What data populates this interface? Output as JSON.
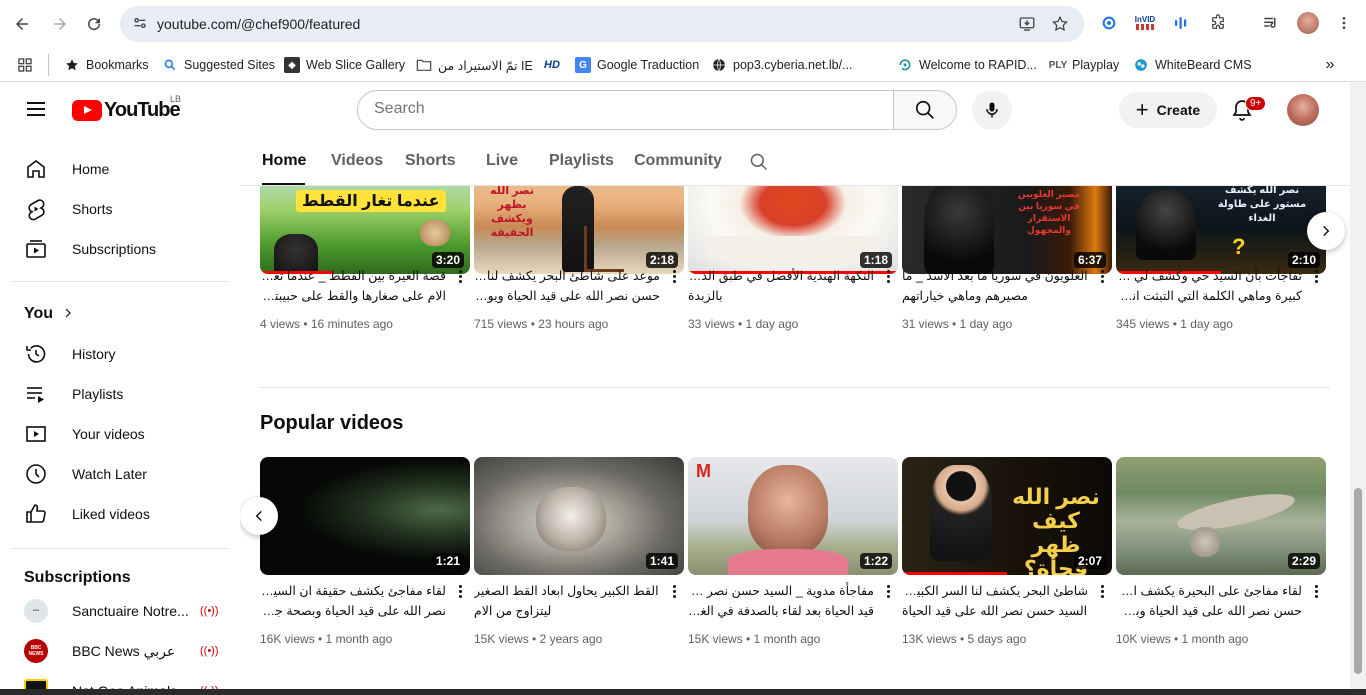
{
  "browser": {
    "url": "youtube.com/@chef900/featured",
    "bookmarks": [
      {
        "label": "Bookmarks",
        "icon": "star-icon"
      },
      {
        "label": "Suggested Sites",
        "icon": "search-icon"
      },
      {
        "label": "Web Slice Gallery",
        "icon": "web-slice-icon"
      },
      {
        "label": "تمّ الاستيراد من IE",
        "icon": "folder-icon"
      },
      {
        "label": "",
        "icon": "hd-icon"
      },
      {
        "label": "Google Traduction",
        "icon": "google-translate-icon"
      },
      {
        "label": "pop3.cyberia.net.lb/...",
        "icon": "globe-icon"
      },
      {
        "label": "Welcome to RAPID...",
        "icon": "rapid-icon"
      },
      {
        "label": "Playplay",
        "icon": "playplay-icon"
      },
      {
        "label": "WhiteBeard CMS",
        "icon": "whitebeard-icon"
      }
    ],
    "ext_invid": "InVID",
    "hd_label": "HD"
  },
  "header": {
    "logo_text": "YouTube",
    "country": "LB",
    "search_placeholder": "Search",
    "create_label": "Create",
    "notif_count": "9+"
  },
  "sidebar": {
    "main": [
      {
        "label": "Home",
        "icon": "home-icon"
      },
      {
        "label": "Shorts",
        "icon": "shorts-icon"
      },
      {
        "label": "Subscriptions",
        "icon": "subscriptions-icon"
      }
    ],
    "you_label": "You",
    "you": [
      {
        "label": "History",
        "icon": "history-icon"
      },
      {
        "label": "Playlists",
        "icon": "playlists-icon"
      },
      {
        "label": "Your videos",
        "icon": "your-videos-icon"
      },
      {
        "label": "Watch Later",
        "icon": "watch-later-icon"
      },
      {
        "label": "Liked videos",
        "icon": "liked-icon"
      }
    ],
    "subs_heading": "Subscriptions",
    "subs": [
      {
        "label": "Sanctuaire Notre...",
        "color": "#dfe6ea"
      },
      {
        "label": "BBC News عربي",
        "color": "#b80000",
        "badge": "BBC NEWS"
      },
      {
        "label": "Nat Geo Animals",
        "color": "#111111"
      }
    ]
  },
  "tabs": [
    {
      "label": "Home",
      "active": true
    },
    {
      "label": "Videos"
    },
    {
      "label": "Shorts"
    },
    {
      "label": "Live"
    },
    {
      "label": "Playlists"
    },
    {
      "label": "Community"
    }
  ],
  "row1": [
    {
      "t1": "قصة الغيرة بين القطط _ عندما تغار القطط",
      "t2": "الام على صغارها والقط على حبيبته الأنثى في ...",
      "meta": "4 views • 16 minutes ago",
      "duration": "3:20",
      "thumb_text": "عندما تغار القطط",
      "progress": 0.35
    },
    {
      "t1": "موعد على شاطئ البحر يكشف لنا ان السيد",
      "t2": "حسن نصر الله على قيد الحياة ويوضح ...",
      "meta": "715 views • 23 hours ago",
      "duration": "2:18",
      "thumb_text": "نصر الله بظهر ويكشف الحقيقة",
      "progress": 0.0
    },
    {
      "t1": "النكهة الهندية الأفضل في طبق الدجاج",
      "t2": "بالزبدة",
      "meta": "33 views • 1 day ago",
      "duration": "1:18",
      "thumb_text": "",
      "progress": 1.0
    },
    {
      "t1": "العلويون في سوريا ما بعد الأسد _ ما",
      "t2": "مصيرهم وماهي خياراتهم",
      "meta": "31 views • 1 day ago",
      "duration": "6:37",
      "thumb_text": "مصير العلويين في سوريا بين الاستقرار والمجهول",
      "progress": 0.0
    },
    {
      "t1": "تفاجأت بأن السيد حي وكشف لي أسرار",
      "t2": "كبيرة وماهي الكلمة التي التبثت انه على قيد ...",
      "meta": "345 views • 1 day ago",
      "duration": "2:10",
      "thumb_text": "نصر الله يكشف مستور على طاولة الغداء",
      "progress": 0.5
    }
  ],
  "popular_heading": "Popular videos",
  "row2": [
    {
      "t1": "لقاء مفاجئ يكشف حقيقة ان السيد حسن",
      "t2": "نصر الله على قيد الحياة وبصحة جيدة",
      "meta": "16K views • 1 month ago",
      "duration": "1:21",
      "thumb_text": "",
      "progress": 0.0
    },
    {
      "t1": "القط الكبير يحاول ابعاد القط الصغير",
      "t2": "ليتزاوج من الام",
      "meta": "15K views • 2 years ago",
      "duration": "1:41",
      "thumb_text": "",
      "progress": 0.0
    },
    {
      "t1": "مفاجأة مدوية _ السيد حسن نصر الله على",
      "t2": "قيد الحياة بعد لقاء بالصدفة في الغابة",
      "meta": "15K views • 1 month ago",
      "duration": "1:22",
      "thumb_text": "M",
      "progress": 0.0
    },
    {
      "t1": "شاطئ البحر يكشف لنا السر الكبير بأن",
      "t2": "السيد حسن نصر الله على قيد الحياة",
      "meta": "13K views • 5 days ago",
      "duration": "2:07",
      "thumb_text": "نصر الله كيف ظهر فجأة؟",
      "progress": 0.5
    },
    {
      "t1": "لقاء مفاجئ على البحيرة يكشف ان السيد",
      "t2": "حسن نصر الله على قيد الحياة وبصحة ...",
      "meta": "10K views • 1 month ago",
      "duration": "2:29",
      "thumb_text": "",
      "progress": 0.0
    }
  ]
}
